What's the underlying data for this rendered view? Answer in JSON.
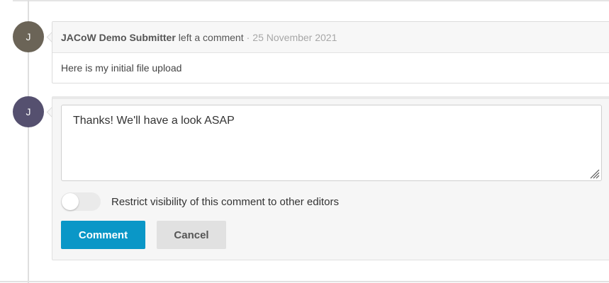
{
  "timeline": {
    "existing_comment": {
      "avatar_initial": "J",
      "author": "JACoW Demo Submitter",
      "action": "left a comment",
      "separator": "·",
      "date": "25 November 2021",
      "body": "Here is my initial file upload"
    },
    "new_comment_form": {
      "avatar_initial": "J",
      "textarea_value": "Thanks! We'll have a look ASAP",
      "restrict_visibility": {
        "label": "Restrict visibility of this comment to other editors",
        "checked": false
      },
      "submit_label": "Comment",
      "cancel_label": "Cancel"
    }
  },
  "colors": {
    "primary_button": "#0a97c7",
    "avatar_1": "#6b6457",
    "avatar_2": "#55506f"
  },
  "icons": {
    "textarea_resize": "resize-grip-icon"
  }
}
